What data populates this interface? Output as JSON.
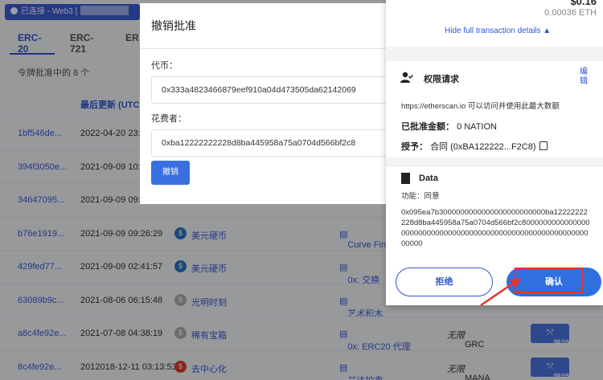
{
  "background": {
    "connection_label": "已连接 - Web3 [",
    "tabs": [
      "ERC-20",
      "ERC-721",
      "ER"
    ],
    "count_label": "令牌批准中的 8 个",
    "col_header": "最后更新 (UTC",
    "rows": [
      {
        "hash": "1bf546de...",
        "time": "2022-04-20 23:",
        "token": "",
        "spender": "",
        "amount": "",
        "amount_token": "",
        "revoke": ""
      },
      {
        "hash": "394f3050e...",
        "time": "2021-09-09 10:",
        "token": "",
        "spender": "",
        "amount": "",
        "amount_token": "",
        "revoke": ""
      },
      {
        "hash": "34647095...",
        "time": "2021-09-09 09:",
        "token": "",
        "spender": "",
        "amount": "",
        "amount_token": "",
        "revoke": ""
      },
      {
        "hash": "b76e1919...",
        "time": "2021-09-09 09:26:29",
        "token": "美元硬币",
        "token_color": "#2775ca",
        "spender": "Curve Fin",
        "amount": "",
        "amount_token": "",
        "revoke": ""
      },
      {
        "hash": "429fed77...",
        "time": "2021-09-09 02:41:57",
        "token": "美元硬币",
        "token_color": "#2775ca",
        "spender": "0x: 交换",
        "amount": "",
        "amount_token": "",
        "revoke": ""
      },
      {
        "hash": "63089b9c...",
        "time": "2021-08-06 06:15:48",
        "token": "光明时刻",
        "token_color": "#b0b0b0",
        "spender": "艺术积木",
        "amount": "",
        "amount_token": "",
        "revoke": ""
      },
      {
        "hash": "a8c4fe92e...",
        "time": "2021-07-08 04:38:19",
        "token": "稀有宝箱",
        "token_color": "#b0b0b0",
        "spender": "0x: ERC20 代理",
        "amount": "无限",
        "amount_token": "GRC",
        "revoke": "撤销"
      },
      {
        "hash": "8c4fe92e...",
        "time": "2012018-12-11 03:13:53",
        "token": "去中心化",
        "token_color": "#e5392b",
        "spender": "兰达拍卖",
        "amount": "无限",
        "amount_token": "MANA",
        "revoke": "撤销"
      }
    ]
  },
  "modal": {
    "title": "撤销批准",
    "token_label": "代币：",
    "token_value": "0x333a4823466879eef910a04d473505da62142069",
    "spender_label": "花费者：",
    "spender_value": "0xba12222222228d8ba445958a75a0704d566bf2c8",
    "revoke_button": "撤销"
  },
  "wallet": {
    "amount_top": "$0.16",
    "eth_value": "0.00036 ETH",
    "hide_details": "Hide full transaction details",
    "perm_title": "权限请求",
    "edit_label": "编辑",
    "perm_desc": "https://etherscan.io 可以访问并使用此最大数额",
    "approved_label": "已批准金额：",
    "approved_value": "0 NATION",
    "grant_label": "授予：",
    "grant_value": "合同 (0xBA122222...F2C8)",
    "data_title": "Data",
    "func_label": "功能：同意",
    "hex_data": "0x095ea7b3000000000000000000000000ba12222222228d8ba445958a75a0704d566bf2c80000000000000000000000000000000000000000000000000000000000000000",
    "reject_button": "拒绝",
    "confirm_button": "确认",
    "accent_color": "#2f6fe0",
    "highlight_color": "#e5342a"
  }
}
